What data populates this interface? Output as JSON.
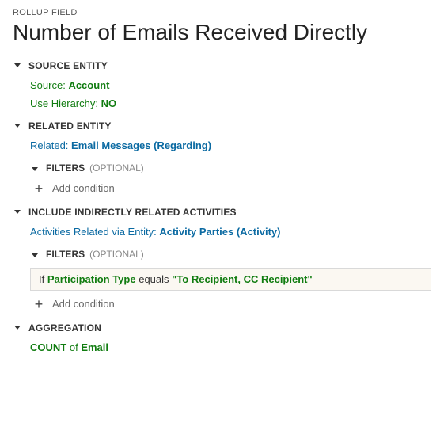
{
  "breadcrumb": "ROLLUP FIELD",
  "title": "Number of Emails Received Directly",
  "sections": {
    "source": {
      "heading": "SOURCE ENTITY",
      "source_label": "Source:",
      "source_value": "Account",
      "hierarchy_label": "Use Hierarchy:",
      "hierarchy_value": "NO"
    },
    "related": {
      "heading": "RELATED ENTITY",
      "related_label": "Related:",
      "related_value": "Email Messages (Regarding)",
      "filters_heading": "FILTERS",
      "filters_optional": "(OPTIONAL)",
      "add_condition": "Add condition"
    },
    "indirect": {
      "heading": "INCLUDE INDIRECTLY RELATED ACTIVITIES",
      "via_label": "Activities Related via Entity:",
      "via_value": "Activity Parties (Activity)",
      "filters_heading": "FILTERS",
      "filters_optional": "(OPTIONAL)",
      "condition_if": "If",
      "condition_field": "Participation Type",
      "condition_op": "equals",
      "condition_val": "\"To Recipient, CC Recipient\"",
      "add_condition": "Add condition"
    },
    "aggregation": {
      "heading": "AGGREGATION",
      "func": "COUNT",
      "of": "of",
      "field": "Email"
    }
  }
}
